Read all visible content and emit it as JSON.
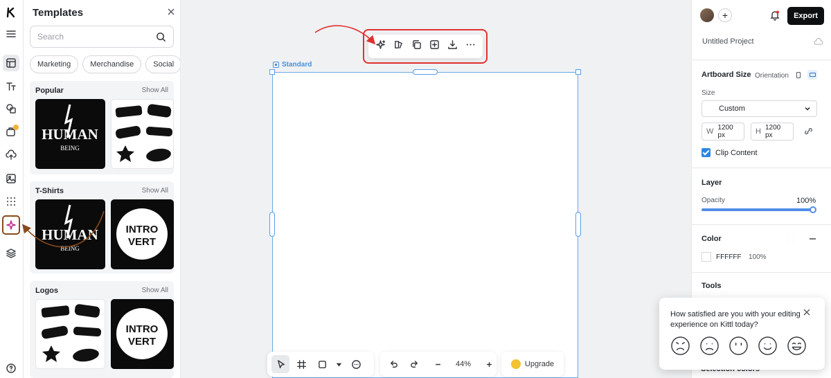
{
  "rail": {
    "items": [
      "logo-icon",
      "menu-icon",
      "templates-icon",
      "text-icon",
      "elements-icon",
      "brand-kit-icon",
      "upload-icon",
      "photos-icon",
      "patterns-icon",
      "ai-tools-icon",
      "layers-icon",
      "help-icon"
    ]
  },
  "templates": {
    "title": "Templates",
    "search_placeholder": "Search",
    "chips": [
      "Marketing",
      "Merchandise",
      "Social"
    ],
    "sections": [
      {
        "title": "Popular",
        "show_all": "Show All"
      },
      {
        "title": "T-Shirts",
        "show_all": "Show All"
      },
      {
        "title": "Logos",
        "show_all": "Show All"
      }
    ],
    "thumb_texts": {
      "human": "HUMAN",
      "being": "BEING",
      "intro": "INTRO",
      "vert": "VERT"
    }
  },
  "canvas": {
    "artboard_label": "Standard",
    "zoom": "44%",
    "upgrade_label": "Upgrade"
  },
  "right": {
    "export_label": "Export",
    "project_name": "Untitled Project",
    "artboard_size_label": "Artboard Size",
    "orientation_label": "Orientation",
    "size_label": "Size",
    "size_value": "Custom",
    "width_label": "W",
    "width_value": "1200 px",
    "height_label": "H",
    "height_value": "1200 px",
    "clip_label": "Clip Content",
    "layer_label": "Layer",
    "opacity_label": "Opacity",
    "opacity_value": "100%",
    "opacity_fraction": 1.0,
    "color_label": "Color",
    "color_hex": "FFFFFF",
    "color_opacity": "100%",
    "tools_label": "Tools",
    "selection_colors_label": "Selection colors"
  },
  "feedback": {
    "question": "How satisfied are you with your editing experience on Kittl today?"
  },
  "colors": {
    "accent": "#4f8de8",
    "highlight_red": "#e03131",
    "highlight_brown": "#8a4b1c"
  }
}
